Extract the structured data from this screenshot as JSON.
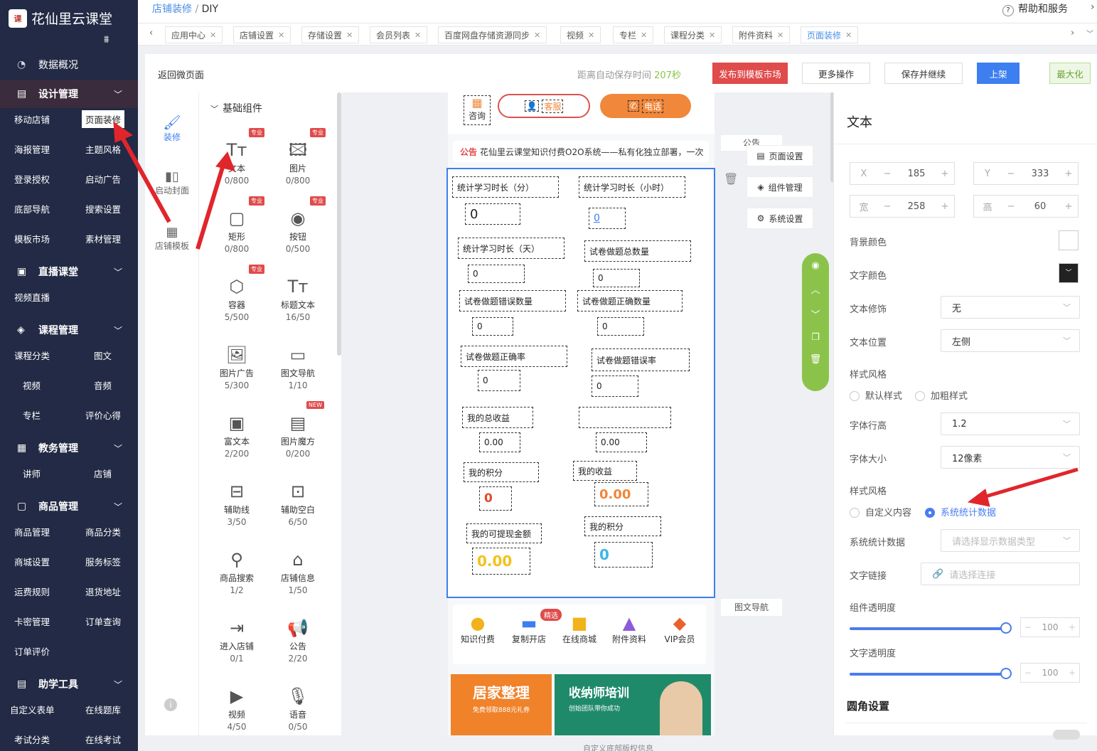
{
  "app": {
    "title": "花仙里云课堂",
    "logo_mark": "课"
  },
  "sidebar": {
    "top_item": "数据概况",
    "groups": [
      {
        "label": "设计管理",
        "subs": [
          "移动店铺",
          "页面装修",
          "海报管理",
          "主题风格",
          "登录授权",
          "启动广告",
          "底部导航",
          "搜索设置",
          "模板市场",
          "素材管理"
        ]
      },
      {
        "label": "直播课堂",
        "subs": [
          "视频直播"
        ]
      },
      {
        "label": "课程管理",
        "subs": [
          "课程分类",
          "图文",
          "视频",
          "音频",
          "专栏",
          "评价心得"
        ]
      },
      {
        "label": "教务管理",
        "subs": [
          "讲师",
          "店铺"
        ]
      },
      {
        "label": "商品管理",
        "subs": [
          "商品管理",
          "商品分类",
          "商城设置",
          "服务标签",
          "运费规则",
          "退货地址",
          "卡密管理",
          "订单查询",
          "订单评价"
        ]
      },
      {
        "label": "助学工具",
        "subs": [
          "自定义表单",
          "在线题库",
          "考试分类",
          "在线考试"
        ]
      }
    ]
  },
  "breadcrumb": {
    "parent": "店铺装修",
    "sep": "/",
    "current": "DIY"
  },
  "help": "帮助和服务",
  "tabs": [
    "应用中心",
    "店铺设置",
    "存储设置",
    "会员列表",
    "百度网盘存储资源同步",
    "视频",
    "专栏",
    "课程分类",
    "附件资料",
    "页面装修"
  ],
  "editor": {
    "back": "返回微页面",
    "autosave_label": "距离自动保存时间",
    "autosave_value": "207秒",
    "btn_publish": "发布到模板市场",
    "btn_more": "更多操作",
    "btn_save": "保存并继续",
    "btn_online": "上架",
    "btn_max": "最大化"
  },
  "left_tabs": [
    "装修",
    "启动封面",
    "店铺模板"
  ],
  "components": {
    "section": "基础组件",
    "pro_badge": "专业",
    "new_badge": "NEW",
    "items": [
      {
        "name": "文本",
        "count": "0/800"
      },
      {
        "name": "图片",
        "count": "0/800"
      },
      {
        "name": "矩形",
        "count": "0/800"
      },
      {
        "name": "按钮",
        "count": "0/500"
      },
      {
        "name": "容器",
        "count": "5/500"
      },
      {
        "name": "标题文本",
        "count": "16/50"
      },
      {
        "name": "图片广告",
        "count": "5/300"
      },
      {
        "name": "图文导航",
        "count": "1/10"
      },
      {
        "name": "富文本",
        "count": "2/200"
      },
      {
        "name": "图片魔方",
        "count": "0/200"
      },
      {
        "name": "辅助线",
        "count": "3/50"
      },
      {
        "name": "辅助空白",
        "count": "6/50"
      },
      {
        "name": "商品搜索",
        "count": "1/2"
      },
      {
        "name": "店铺信息",
        "count": "1/50"
      },
      {
        "name": "进入店铺",
        "count": "0/1"
      },
      {
        "name": "公告",
        "count": "2/20"
      },
      {
        "name": "视频",
        "count": "4/50"
      },
      {
        "name": "语音",
        "count": "0/50"
      }
    ]
  },
  "canvas": {
    "top_buttons": {
      "consult": "咨询",
      "service": "客服",
      "phone": "电话"
    },
    "notice_tag": "公告",
    "notice_text": "花仙里云课堂知识付费O2O系统——私有化独立部署，一次",
    "notice_side": "公告",
    "side_buttons": [
      "页面设置",
      "组件管理",
      "系统设置"
    ],
    "stats": [
      {
        "label": "统计学习时长（分）",
        "value": "0"
      },
      {
        "label": "统计学习时长（小时）",
        "value": "0"
      },
      {
        "label": "统计学习时长（天）",
        "value": "0"
      },
      {
        "label": "试卷做题总数量",
        "value": "0"
      },
      {
        "label": "试卷做题错误数量",
        "value": "0"
      },
      {
        "label": "试卷做题正确数量",
        "value": "0"
      },
      {
        "label": "试卷做题正确率",
        "value": "0"
      },
      {
        "label": "试卷做题错误率",
        "value": "0"
      },
      {
        "label": "我的总收益",
        "value": "0.00"
      },
      {
        "label": "",
        "value": "0.00"
      },
      {
        "label": "我的积分",
        "value": "0"
      },
      {
        "label": "我的收益",
        "value": "0.00"
      },
      {
        "label": "我的可提现金额",
        "value": "0.00"
      },
      {
        "label": "我的积分",
        "value": "0"
      }
    ],
    "nav_label": "图文导航",
    "nav_badge": "精选",
    "nav_items": [
      "知识付费",
      "复制开店",
      "在线商城",
      "附件资料",
      "VIP会员"
    ],
    "banner1_title": "居家整理",
    "banner1_sub": "免费领取888元礼券",
    "banner2_title": "收纳师培训",
    "banner2_sub": "创始团队带你成功",
    "footer": "自定义底部版权信息"
  },
  "panel": {
    "title": "文本",
    "x_label": "X",
    "x_value": "185",
    "y_label": "Y",
    "y_value": "333",
    "w_label": "宽",
    "w_value": "258",
    "h_label": "高",
    "h_value": "60",
    "bg_color_label": "背景颜色",
    "text_color_label": "文字颜色",
    "decoration_label": "文本修饰",
    "decoration_value": "无",
    "position_label": "文本位置",
    "position_value": "左侧",
    "style_label": "样式风格",
    "style_opt1": "默认样式",
    "style_opt2": "加粗样式",
    "lineheight_label": "字体行高",
    "lineheight_value": "1.2",
    "fontsize_label": "字体大小",
    "fontsize_value": "12像素",
    "style2_label": "样式风格",
    "style2_opt1": "自定义内容",
    "style2_opt2": "系统统计数据",
    "stat_label": "系统统计数据",
    "stat_placeholder": "请选择显示数据类型",
    "link_label": "文字链接",
    "link_placeholder": "请选择连接",
    "opacity_label": "组件透明度",
    "opacity_value": "100",
    "text_opacity_label": "文字透明度",
    "text_opacity_value": "100",
    "radius_label": "圆角设置"
  },
  "colors": {
    "sidebar": "#222a45",
    "accent": "#4a90e2",
    "red": "#e04b4b",
    "green": "#8bc34a",
    "orange": "#f0873a"
  }
}
